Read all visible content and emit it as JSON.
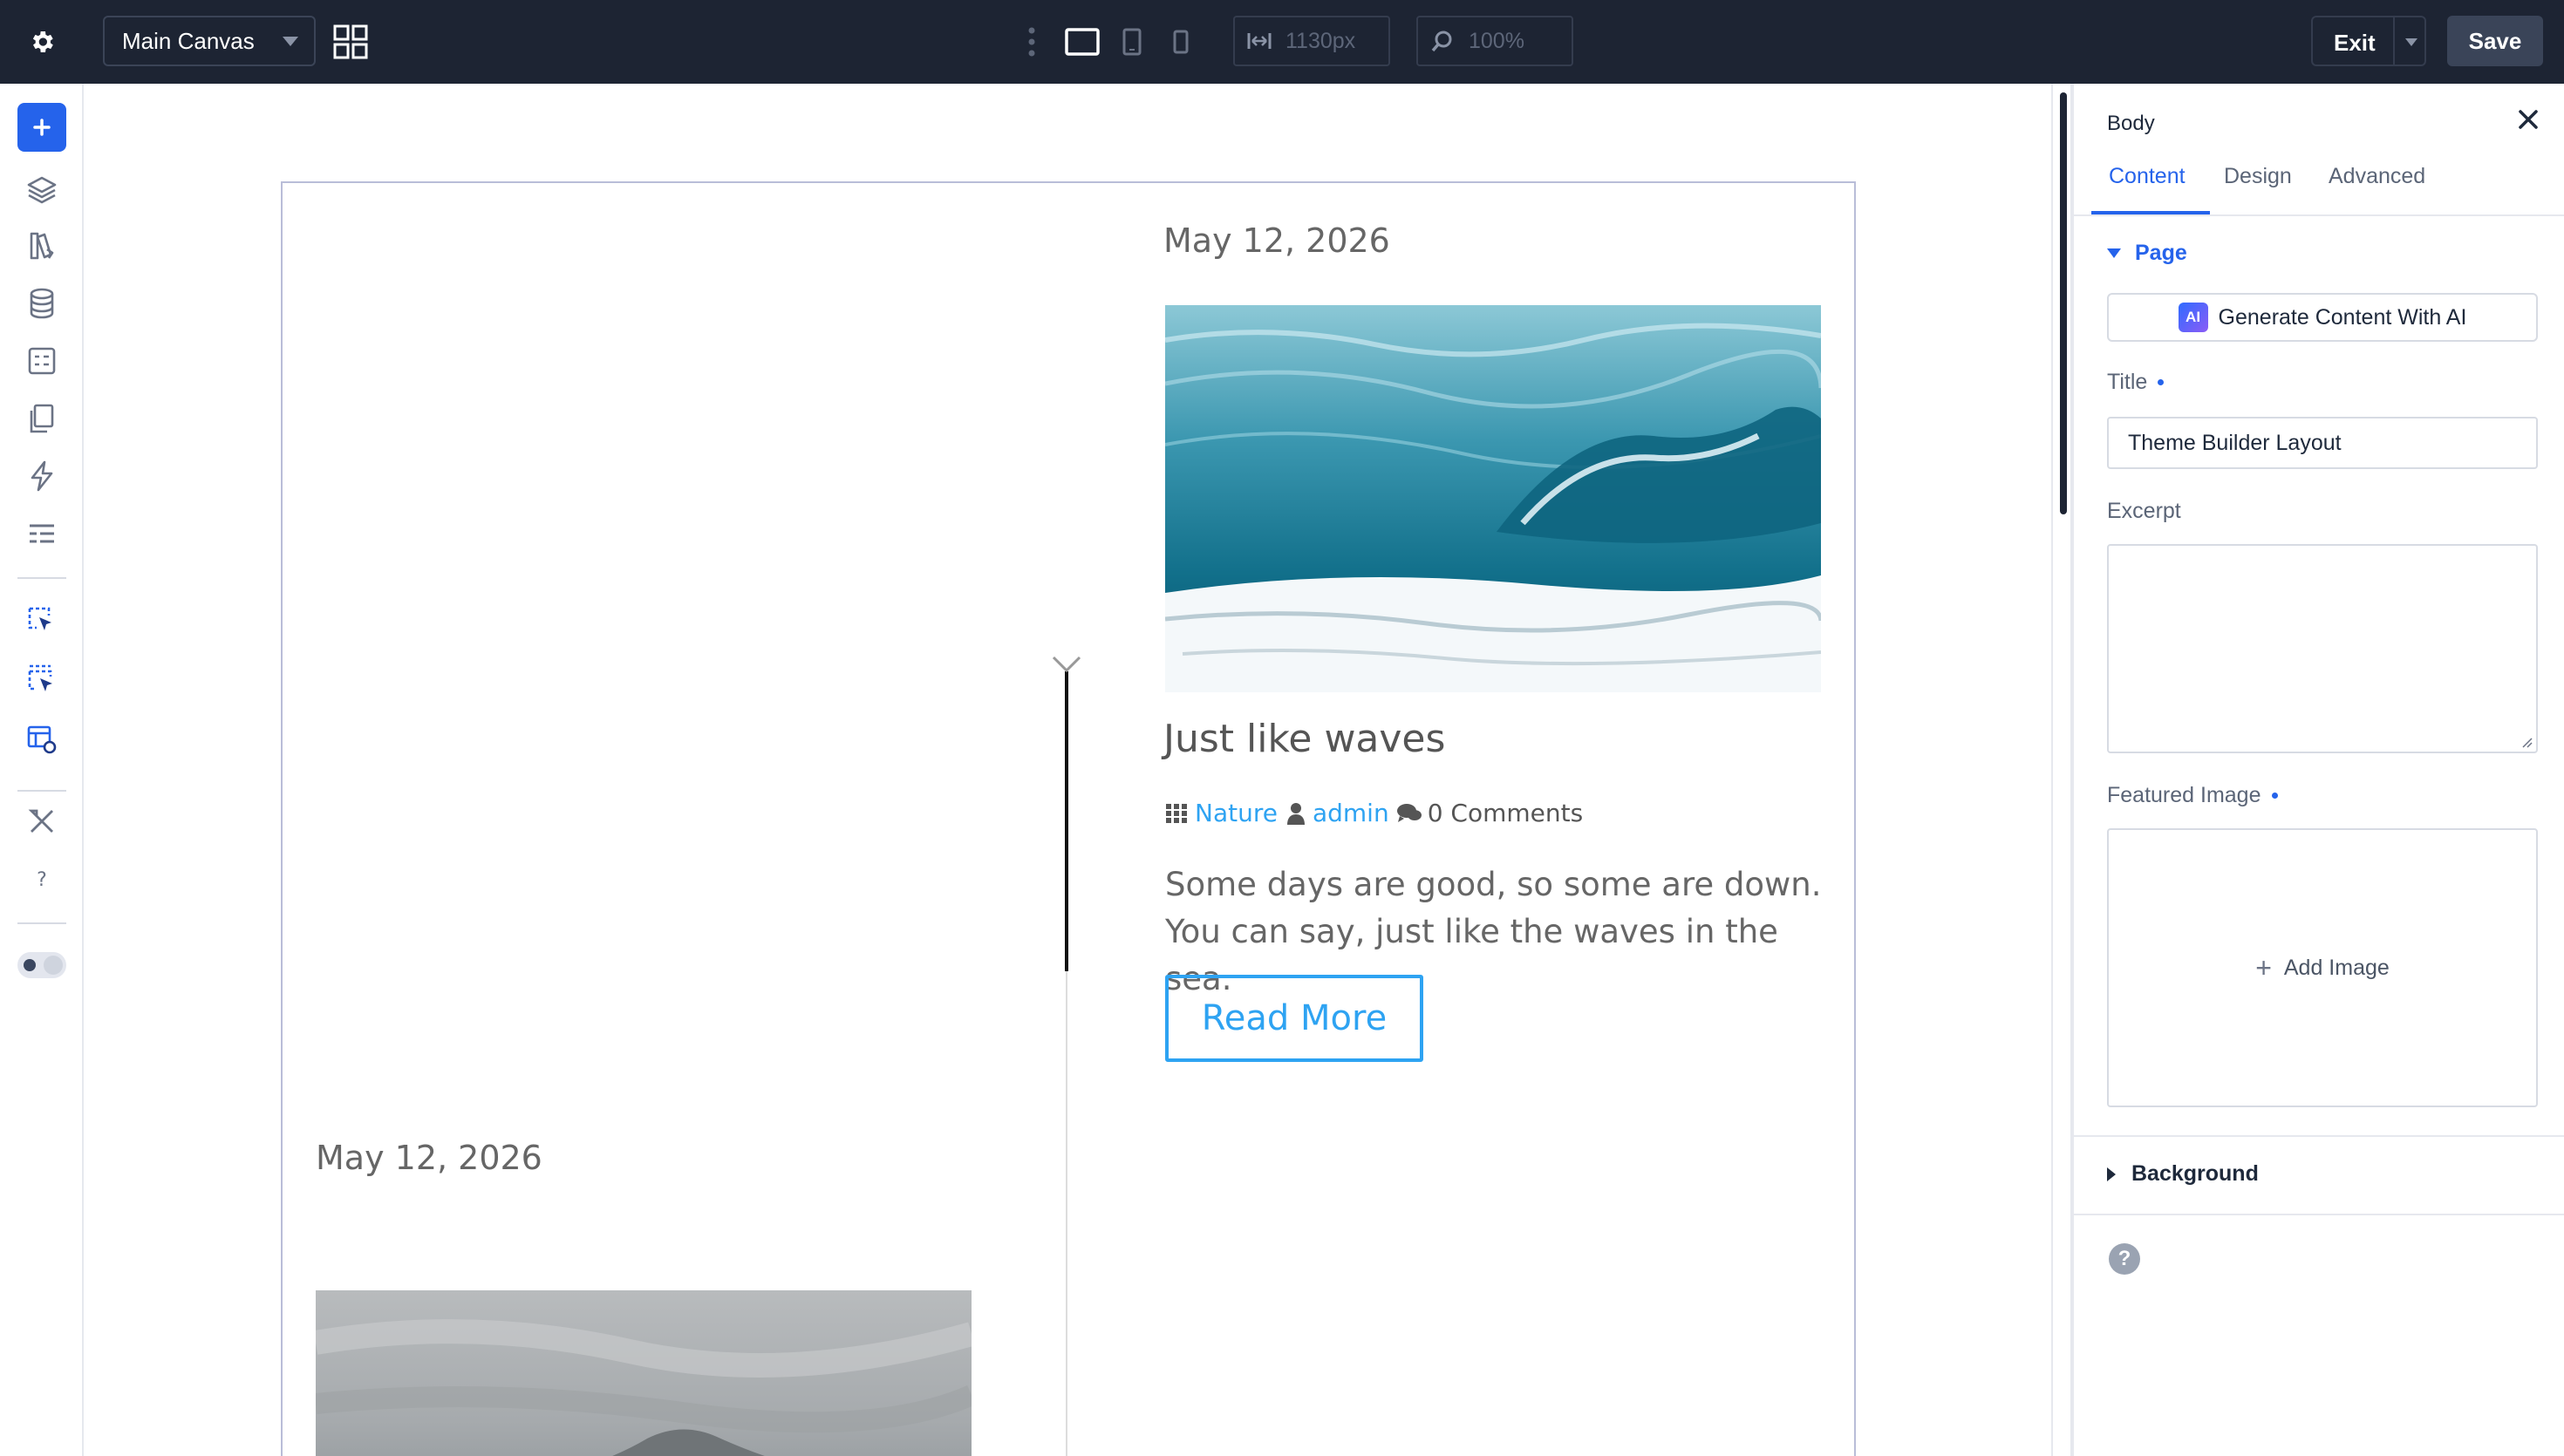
{
  "toolbar": {
    "canvas_select": "Main Canvas",
    "width_value": "1130px",
    "zoom_value": "100%",
    "exit_label": "Exit",
    "save_label": "Save"
  },
  "sidebar": {
    "icons": [
      "add-icon",
      "layers-icon",
      "theme-builder-icon",
      "database-icon",
      "form-icon",
      "pages-icon",
      "lightning-icon",
      "list-icon",
      "select-icon",
      "multi-select-icon",
      "layout-settings-icon",
      "tools-icon",
      "help-icon",
      "dark-mode-toggle"
    ]
  },
  "canvas": {
    "post1": {
      "date": "May 12, 2026",
      "title": "Just like waves",
      "category": "Nature",
      "author": "admin",
      "comments": "0 Comments",
      "excerpt_line1": "Some days are good, so some are down.",
      "excerpt_line2": "You can say, just like the waves in the sea.",
      "read_more": "Read More"
    },
    "post2": {
      "date": "May 12, 2026"
    },
    "colors": {
      "link": "#2ea3f2",
      "accent": "#2563eb",
      "topbar": "#1d2433"
    }
  },
  "panel": {
    "title": "Body",
    "tabs": [
      "Content",
      "Design",
      "Advanced"
    ],
    "active_tab": "Content",
    "page_section": "Page",
    "ai_badge": "AI",
    "ai_button": "Generate Content With AI",
    "title_label": "Title",
    "title_value": "Theme Builder Layout",
    "excerpt_label": "Excerpt",
    "featured_image_label": "Featured Image",
    "add_image": "Add Image",
    "background_section": "Background",
    "help": "?"
  }
}
